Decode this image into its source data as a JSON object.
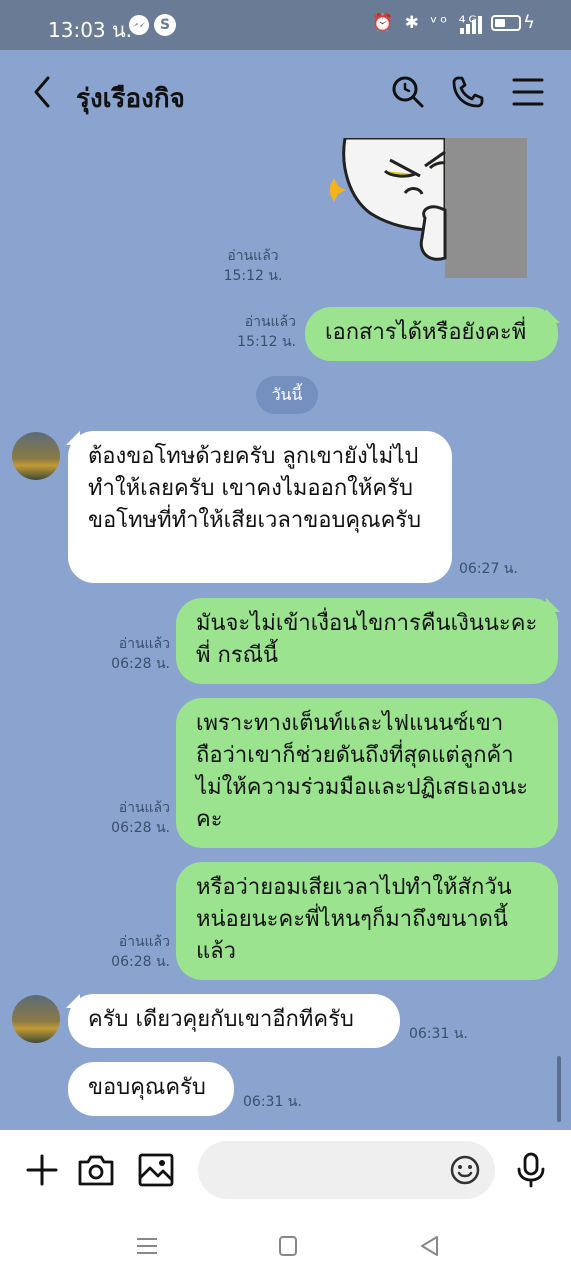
{
  "status_bar": {
    "time": "13:03 น.",
    "badge1": "S",
    "icons_text": "⏰ ✱ ᵛᵒ ⁴ᴳ"
  },
  "header": {
    "title": "รุ่งเรืองกิจ"
  },
  "chat": {
    "messages": [
      {
        "type": "sticker",
        "meta_read": "อ่านแล้ว",
        "meta_time": "15:12 น."
      },
      {
        "type": "out",
        "text": "เอกสารได้หรือยังคะพี่",
        "meta_read": "อ่านแล้ว",
        "meta_time": "15:12 น."
      },
      {
        "type": "date",
        "text": "วันนี้"
      },
      {
        "type": "in",
        "text": "ต้องขอโทษด้วยครับ ลูกเขายังไม่ไปทำให้เลยครับ เขาคงไมออกให้ครับ ขอโทษที่ทำให้เสียเวลาขอบคุณครับ",
        "meta_time": "06:27 น."
      },
      {
        "type": "out",
        "text": "มันจะไม่เข้าเงื่อนไขการคืนเงินนะคะพี่ กรณีนี้",
        "meta_read": "อ่านแล้ว",
        "meta_time": "06:28 น."
      },
      {
        "type": "out",
        "text": "เพราะทางเต็นท์และไฟแนนซ์เขาถือว่าเขาก็ช่วยดันถึงที่สุดแต่ลูกค้าไม่ให้ความร่วมมือและปฏิเสธเองนะคะ",
        "meta_read": "อ่านแล้ว",
        "meta_time": "06:28 น."
      },
      {
        "type": "out",
        "text": "หรือว่ายอมเสียเวลาไปทำให้สักวันหน่อยนะคะพี่ไหนๆก็มาถึงขนาดนี้แล้ว",
        "meta_read": "อ่านแล้ว",
        "meta_time": "06:28 น."
      },
      {
        "type": "in",
        "text": "ครับ  เดียวคุยกับเขาอีกทีครับ",
        "meta_time": "06:31 น."
      },
      {
        "type": "in",
        "text": "ขอบคุณครับ",
        "meta_time": "06:31 น."
      }
    ]
  },
  "colors": {
    "chat_bg": "#8aa4cf",
    "bubble_out": "#9be38f",
    "bubble_in": "#ffffff",
    "status_bar": "#6a7c95"
  },
  "icons": [
    "back-icon",
    "search-icon",
    "phone-icon",
    "menu-icon",
    "plus-icon",
    "camera-icon",
    "image-icon",
    "emoji-icon",
    "mic-icon",
    "nav-menu-icon",
    "nav-home-icon",
    "nav-back-icon"
  ],
  "battery_level": 0.45
}
